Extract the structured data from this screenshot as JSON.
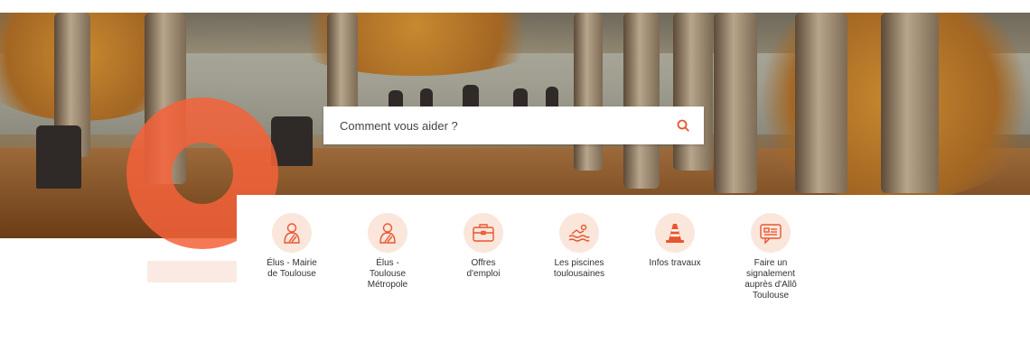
{
  "search": {
    "placeholder": "Comment vous aider ?"
  },
  "shortcuts": [
    {
      "label": "Élus - Mairie\nde Toulouse",
      "icon": "person-icon"
    },
    {
      "label": "Élus -\nToulouse\nMétropole",
      "icon": "person-icon"
    },
    {
      "label": "Offres\nd'emploi",
      "icon": "briefcase-icon"
    },
    {
      "label": "Les piscines\ntoulousaines",
      "icon": "swimming-icon"
    },
    {
      "label": "Infos travaux",
      "icon": "traffic-cone-icon"
    },
    {
      "label": "Faire un\nsignalement\nauprès d'Allô\nToulouse",
      "icon": "chat-report-icon"
    }
  ],
  "colors": {
    "accent": "#e8562e",
    "icon_bg": "#fbe6dc",
    "logo": "#f4613a",
    "logo_tail": "#fbeae3"
  }
}
